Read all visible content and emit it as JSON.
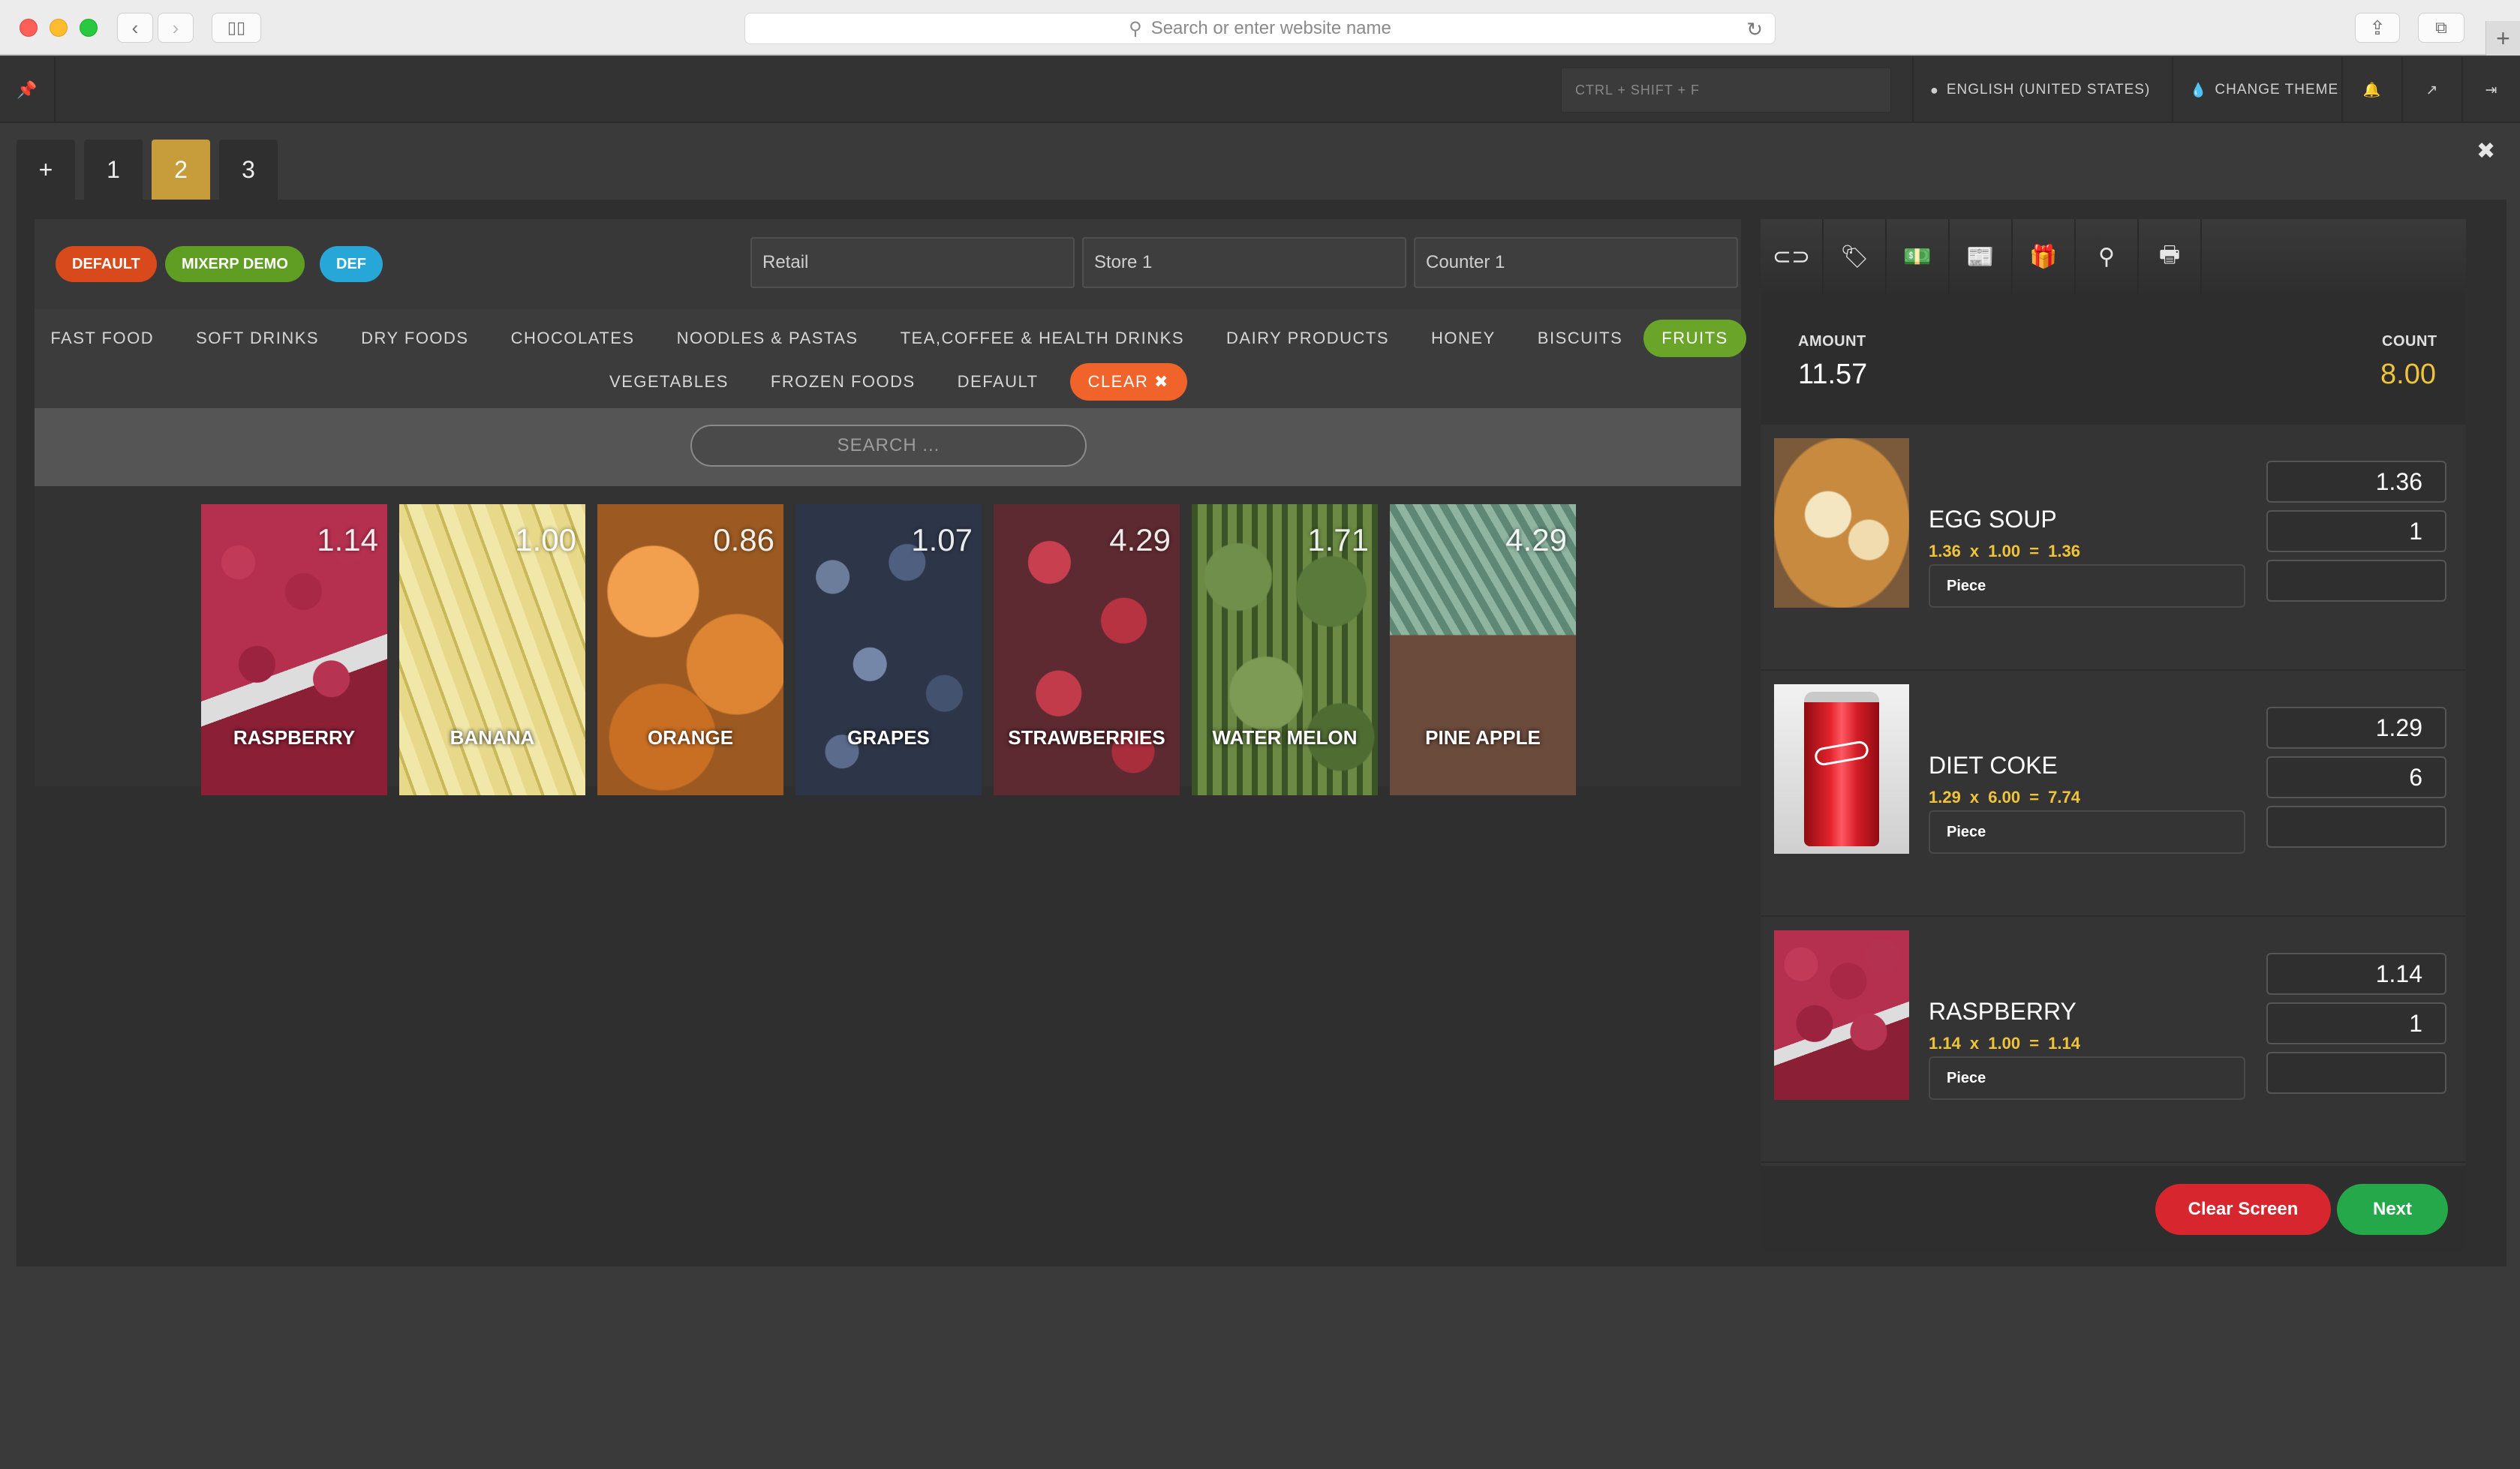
{
  "browser": {
    "address_placeholder": "Search or enter website name"
  },
  "topbar": {
    "shortcut": "CTRL + SHIFT + F",
    "language": "ENGLISH (UNITED STATES)",
    "theme": "CHANGE THEME"
  },
  "tabs": {
    "add": "+",
    "items": [
      "1",
      "2",
      "3"
    ],
    "active": "2",
    "close": "✖"
  },
  "filters": {
    "pills": [
      "DEFAULT",
      "MIXERP DEMO",
      "DEF"
    ],
    "fields": [
      "Retail",
      "Store 1",
      "Counter 1"
    ]
  },
  "categories": {
    "row1": [
      "FAST FOOD",
      "SOFT DRINKS",
      "DRY FOODS",
      "CHOCOLATES",
      "NOODLES & PASTAS",
      "TEA,COFFEE & HEALTH DRINKS",
      "DAIRY PRODUCTS",
      "HONEY",
      "BISCUITS",
      "FRUITS"
    ],
    "row2": [
      "VEGETABLES",
      "FROZEN FOODS",
      "DEFAULT"
    ],
    "active": "FRUITS",
    "clear": "CLEAR"
  },
  "search": {
    "placeholder": "SEARCH ..."
  },
  "products": [
    {
      "name": "RASPBERRY",
      "price": "1.14"
    },
    {
      "name": "BANANA",
      "price": "1.00"
    },
    {
      "name": "ORANGE",
      "price": "0.86"
    },
    {
      "name": "GRAPES",
      "price": "1.07"
    },
    {
      "name": "STRAWBERRIES",
      "price": "4.29"
    },
    {
      "name": "WATER MELON",
      "price": "1.71"
    },
    {
      "name": "PINE APPLE",
      "price": "4.29"
    }
  ],
  "totals": {
    "amount_label": "AMOUNT",
    "amount": "11.57",
    "count_label": "COUNT",
    "count": "8.00"
  },
  "cart": [
    {
      "name": "EGG SOUP",
      "calc": "1.36 x 1.00 = 1.36",
      "unit": "Piece",
      "price": "1.36",
      "qty": "1",
      "discount": ""
    },
    {
      "name": "DIET COKE",
      "calc": "1.29 x 6.00 = 7.74",
      "unit": "Piece",
      "price": "1.29",
      "qty": "6",
      "discount": ""
    },
    {
      "name": "RASPBERRY",
      "calc": "1.14 x 1.00 = 1.14",
      "unit": "Piece",
      "price": "1.14",
      "qty": "1",
      "discount": ""
    }
  ],
  "footer": {
    "clear_screen": "Clear Screen",
    "next": "Next"
  },
  "colors": {
    "accent_tab": "#c79c3a",
    "fruits_active": "#6aa52a",
    "clear_orange": "#f0642b",
    "count_yellow": "#f0c43a",
    "clear_button": "#d8262f",
    "next_button": "#24a84a"
  }
}
